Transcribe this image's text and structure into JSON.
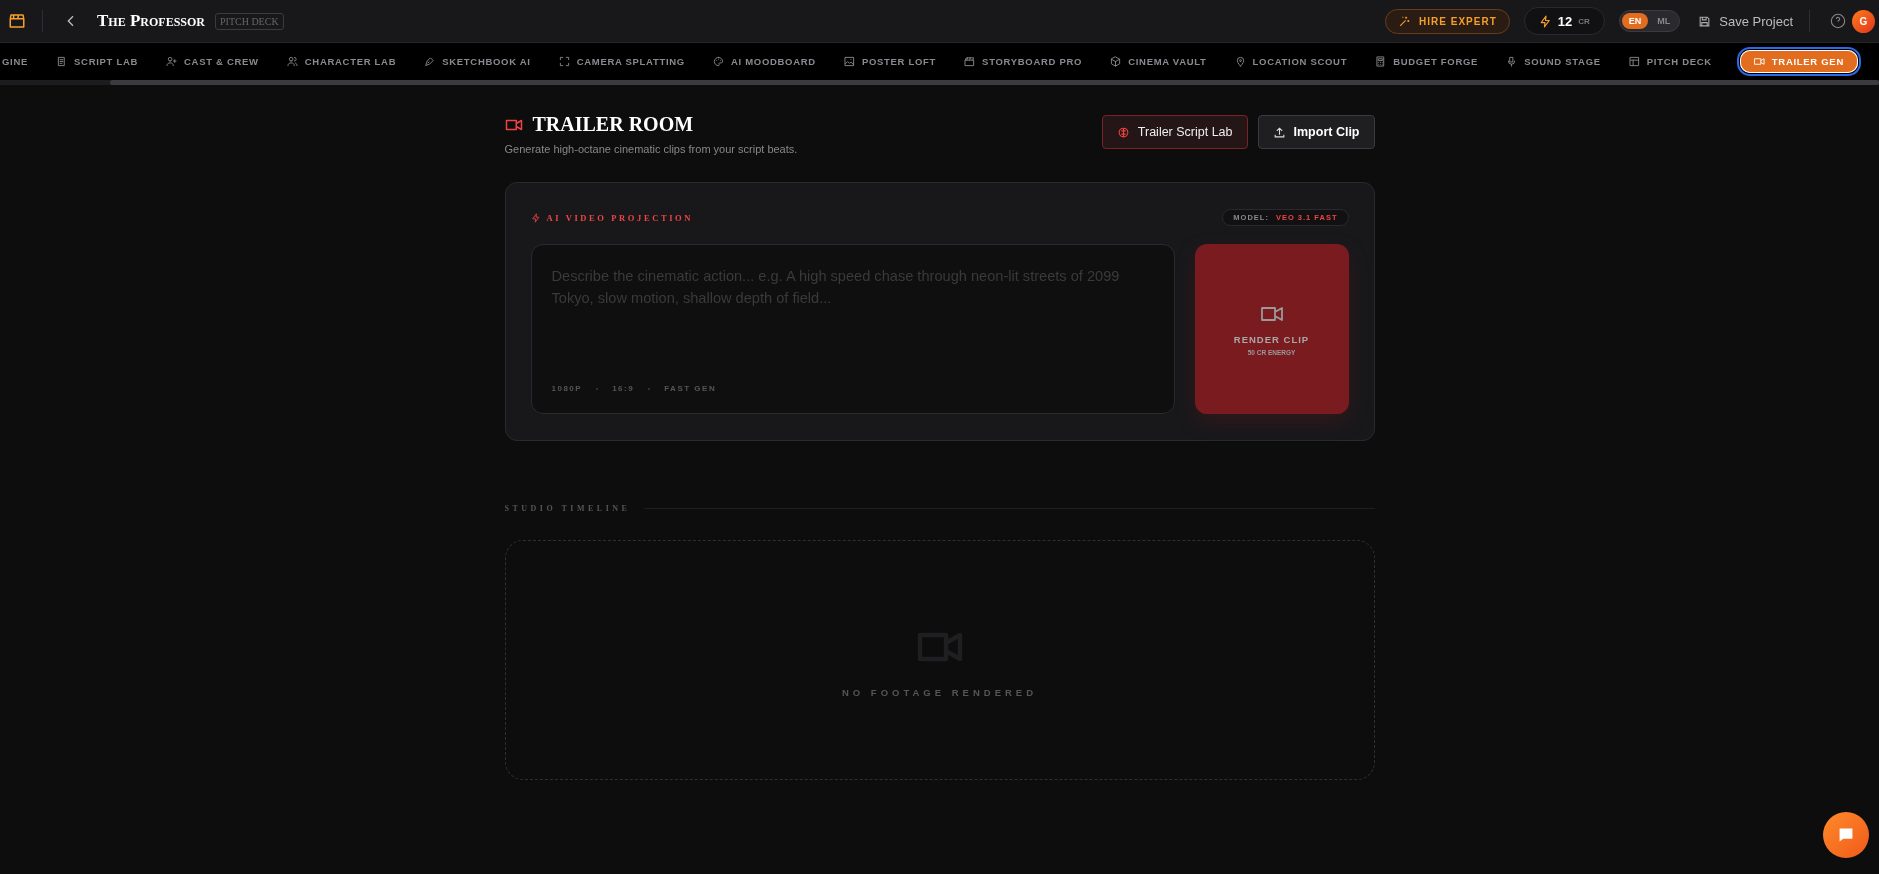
{
  "header": {
    "title": "The Professor",
    "badge": "PITCH DECK",
    "hire_button": "HIRE EXPERT",
    "credits": {
      "amount": "12",
      "unit": "CR"
    },
    "languages": [
      {
        "label": "EN",
        "selected": true
      },
      {
        "label": "ML",
        "selected": false
      }
    ],
    "save_button": "Save Project",
    "avatar": "G"
  },
  "tabs": [
    {
      "label": "GINE",
      "selected": false
    },
    {
      "label": "SCRIPT LAB",
      "selected": false
    },
    {
      "label": "CAST & CREW",
      "selected": false
    },
    {
      "label": "CHARACTER LAB",
      "selected": false
    },
    {
      "label": "SKETCHBOOK AI",
      "selected": false
    },
    {
      "label": "CAMERA SPLATTING",
      "selected": false
    },
    {
      "label": "AI MOODBOARD",
      "selected": false
    },
    {
      "label": "POSTER LOFT",
      "selected": false
    },
    {
      "label": "STORYBOARD PRO",
      "selected": false
    },
    {
      "label": "CINEMA VAULT",
      "selected": false
    },
    {
      "label": "LOCATION SCOUT",
      "selected": false
    },
    {
      "label": "BUDGET FORGE",
      "selected": false
    },
    {
      "label": "SOUND STAGE",
      "selected": false
    },
    {
      "label": "PITCH DECK",
      "selected": false
    },
    {
      "label": "TRAILER GEN",
      "selected": true
    }
  ],
  "page": {
    "title": "TRAILER ROOM",
    "subtitle": "Generate high-octane cinematic clips from your script beats.",
    "buttons": [
      "Trailer Script Lab",
      "Import Clip"
    ]
  },
  "generator": {
    "title": "AI VIDEO PROJECTION",
    "model_label": "MODEL:",
    "model": "VEO 3.1 FAST",
    "prompt": {
      "placeholder": "Describe the cinematic action... e.g. A high speed chase through neon-lit streets of 2099 Tokyo, slow motion, shallow depth of field..."
    },
    "specs": [
      "1080P",
      "16:9",
      "FAST GEN"
    ],
    "render_button": {
      "label": "RENDER CLIP",
      "cost": "50 CR ENERGY"
    }
  },
  "timeline": {
    "title": "STUDIO TIMELINE",
    "empty_text": "NO FOOTAGE RENDERED"
  }
}
